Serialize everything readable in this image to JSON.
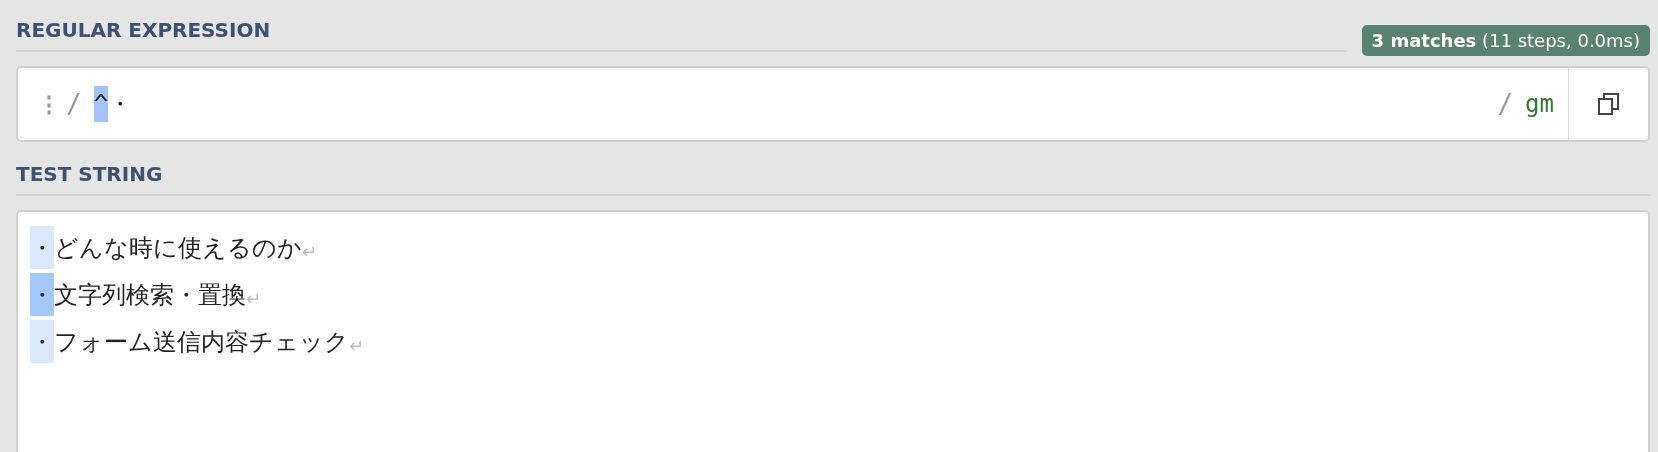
{
  "regex_section": {
    "heading": "REGULAR EXPRESSION",
    "badge": "**3 matches** (11 steps, 0.0ms)",
    "field": {
      "menu": "⋮",
      "open_delimiter": "/",
      "tokens": [
        {
          "text": "^",
          "selected": true
        },
        {
          "text": "・",
          "selected": false
        }
      ],
      "close_delimiter": "/",
      "flags": "gm"
    }
  },
  "test_section": {
    "heading": "TEST STRING",
    "lines": [
      {
        "match": "・",
        "text": "どんな時に使えるのか",
        "selected": false,
        "eol": "↵"
      },
      {
        "match": "・",
        "text": "文字列検索・置換",
        "selected": true,
        "eol": "↵"
      },
      {
        "match": "・",
        "text": "フォーム送信内容チェック",
        "selected": false,
        "eol": "↵"
      }
    ]
  }
}
